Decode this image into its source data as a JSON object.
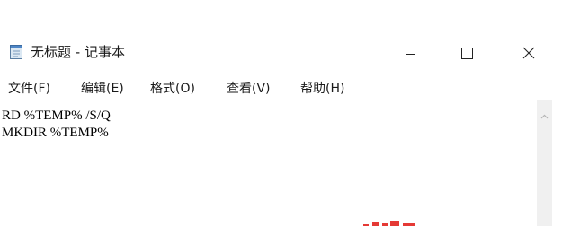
{
  "window": {
    "title": "无标题 - 记事本",
    "icon": "notepad-icon"
  },
  "controls": {
    "minimize_icon": "minimize-icon",
    "maximize_icon": "maximize-icon",
    "close_icon": "close-icon"
  },
  "menu": {
    "items": [
      {
        "label": "文件(F)"
      },
      {
        "label": "编辑(E)"
      },
      {
        "label": "格式(O)"
      },
      {
        "label": "查看(V)"
      },
      {
        "label": "帮助(H)"
      }
    ]
  },
  "editor": {
    "content": "RD %TEMP% /S/Q\nMKDIR %TEMP%"
  },
  "scrollbar": {
    "up_icon": "chevron-up-icon"
  },
  "colors": {
    "background": "#ffffff",
    "text": "#1a1a1a",
    "scrollbar": "#f0f0f0",
    "watermark": "#e53935"
  }
}
